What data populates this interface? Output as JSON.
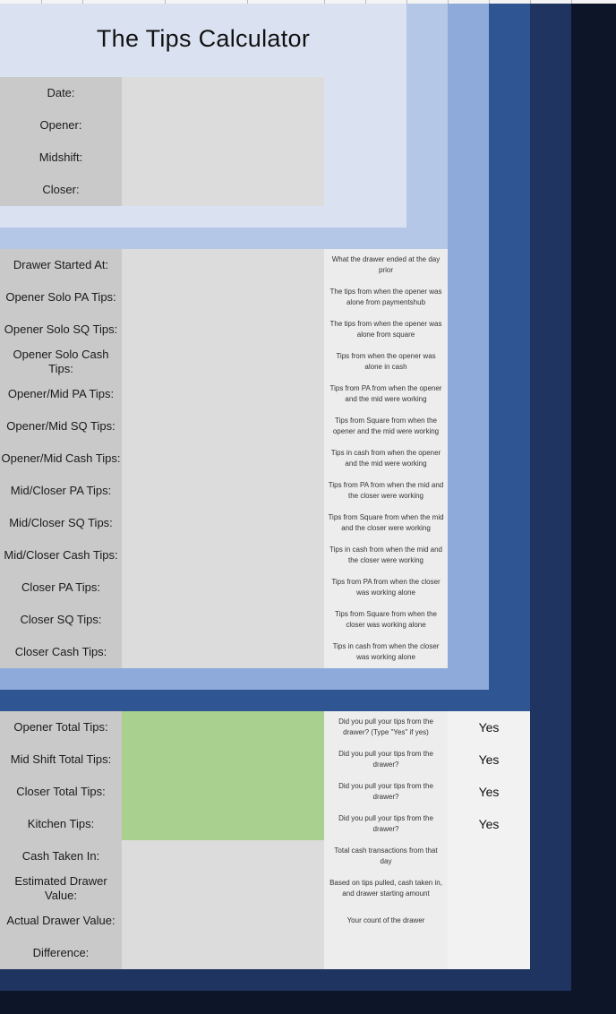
{
  "title": "The Tips Calculator",
  "header_fields": [
    "Date:",
    "Opener:",
    "Midshift:",
    "Closer:"
  ],
  "tip_rows": [
    {
      "label": "Drawer Started At:",
      "hint": "What the drawer ended at the day prior"
    },
    {
      "label": "Opener Solo PA Tips:",
      "hint": "The tips from when the opener was alone from paymentshub"
    },
    {
      "label": "Opener Solo SQ Tips:",
      "hint": "The tips from when the opener was alone from square"
    },
    {
      "label": "Opener Solo Cash Tips:",
      "hint": "Tips from when the opener was alone in cash"
    },
    {
      "label": "Opener/Mid PA Tips:",
      "hint": "Tips from PA from when the opener and the mid were working"
    },
    {
      "label": "Opener/Mid SQ Tips:",
      "hint": "Tips from Square from when the opener and the mid were working"
    },
    {
      "label": "Opener/Mid Cash Tips:",
      "hint": "Tips in cash from when the opener and the mid were working"
    },
    {
      "label": "Mid/Closer PA Tips:",
      "hint": "Tips from PA from when the mid and the closer were working"
    },
    {
      "label": "Mid/Closer SQ Tips:",
      "hint": "Tips from Square from when the mid and the closer were working"
    },
    {
      "label": "Mid/Closer Cash Tips:",
      "hint": "Tips in cash from when the mid and the closer were working"
    },
    {
      "label": "Closer PA Tips:",
      "hint": "Tips from PA from when the closer was working alone"
    },
    {
      "label": "Closer SQ Tips:",
      "hint": "Tips from Square from when the closer was working alone"
    },
    {
      "label": "Closer Cash Tips:",
      "hint": "Tips in cash from when the closer was working alone"
    }
  ],
  "total_rows": [
    {
      "label": "Opener Total Tips:",
      "hint": "Did you pull your tips from the drawer? (Type \"Yes\" if yes)",
      "answer": "Yes"
    },
    {
      "label": "Mid Shift Total Tips:",
      "hint": "Did you pull your tips from the drawer?",
      "answer": "Yes"
    },
    {
      "label": "Closer Total Tips:",
      "hint": "Did you pull your tips from the drawer?",
      "answer": "Yes"
    },
    {
      "label": "Kitchen Tips:",
      "hint": "Did you pull your tips from the drawer?",
      "answer": "Yes"
    }
  ],
  "drawer_rows": [
    {
      "label": "Cash Taken In:",
      "hint": "Total cash transactions from that day"
    },
    {
      "label": "Estimated Drawer Value:",
      "hint": "Based on tips pulled, cash taken in, and drawer starting amount"
    },
    {
      "label": "Actual Drawer Value:",
      "hint": "Your count of the drawer"
    },
    {
      "label": "Difference:",
      "hint": ""
    }
  ],
  "colors": {
    "outer_bg": "#0d1629",
    "frame_dark": "#1f3461",
    "frame_mid": "#2f5593",
    "frame_blue": "#8eaadb",
    "frame_light": "#b4c7e7",
    "frame_pale": "#dae2f2",
    "label_gray": "#c9c9c9",
    "input_gray": "#dcdcdc",
    "total_green": "#a9d08e"
  }
}
